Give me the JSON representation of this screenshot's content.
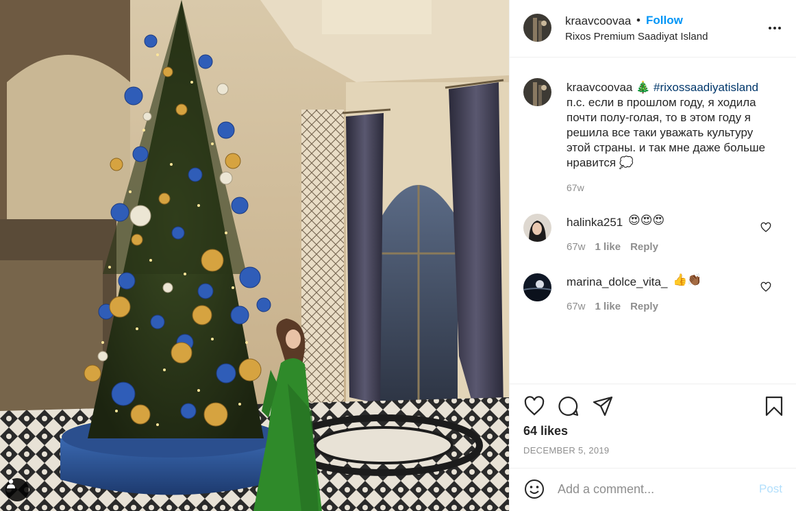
{
  "post": {
    "username": "kraavcoovaa",
    "follow_separator": "•",
    "follow_label": "Follow",
    "location": "Rixos Premium Saadiyat Island",
    "more_icon": "more-horizontal-icon"
  },
  "caption": {
    "username": "kraavcoovaa",
    "tree_emoji": "🎄",
    "hashtag": "#rixossaadiyatisland",
    "text": "п.с. если в прошлом году, я ходила почти полу-голая, то в этом году я решила все таки уважать культуру этой страны. и так мне даже больше нравится",
    "speech_emoji": "💭",
    "time": "67w"
  },
  "comments": [
    {
      "username": "halinka251",
      "emoji": "😍😍😍",
      "time": "67w",
      "likes": "1 like",
      "reply": "Reply"
    },
    {
      "username": "marina_dolce_vita_",
      "emoji": "👍👏🏾",
      "time": "67w",
      "likes": "1 like",
      "reply": "Reply"
    }
  ],
  "actions": {
    "likes": "64 likes",
    "date": "DECEMBER 5, 2019",
    "icons": [
      "heart-icon",
      "comment-icon",
      "share-icon",
      "bookmark-icon"
    ]
  },
  "add_comment": {
    "placeholder": "Add a comment...",
    "post_label": "Post"
  },
  "colors": {
    "accent": "#0095f6",
    "hashtag": "#00376b",
    "muted": "#8e8e8e",
    "post_disabled": "#b2dffc"
  }
}
